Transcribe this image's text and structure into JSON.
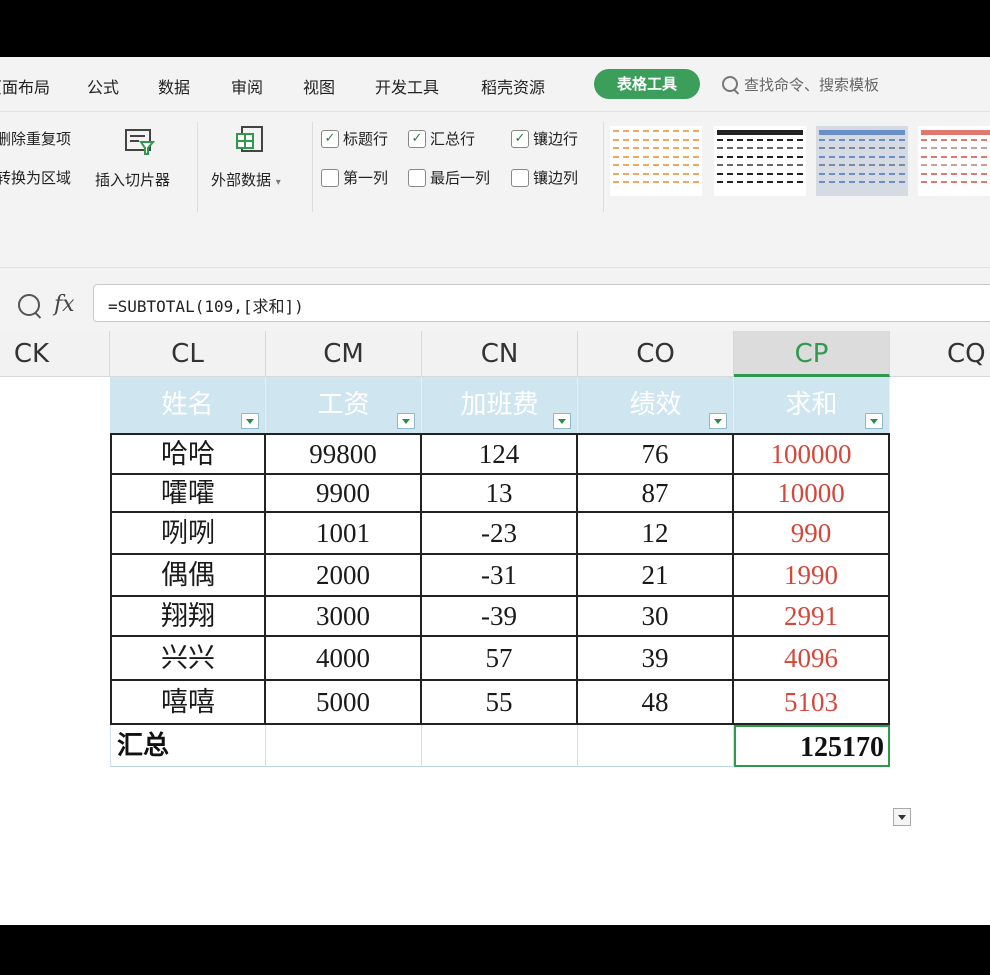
{
  "menu": {
    "items": [
      "页面布局",
      "公式",
      "数据",
      "审阅",
      "视图",
      "开发工具",
      "稻壳资源"
    ],
    "active_tool": "表格工具",
    "search_placeholder": "查找命令、搜索模板"
  },
  "ribbon": {
    "remove_duplicates": "删除重复项",
    "convert_to_range": "转换为区域",
    "insert_slicer": "插入切片器",
    "external_data": "外部数据",
    "options": [
      {
        "label": "标题行",
        "checked": true
      },
      {
        "label": "汇总行",
        "checked": true
      },
      {
        "label": "镶边行",
        "checked": true
      },
      {
        "label": "第一列",
        "checked": false
      },
      {
        "label": "最后一列",
        "checked": false
      },
      {
        "label": "镶边列",
        "checked": false
      }
    ],
    "style_colors": [
      "#f0a860",
      "#222222",
      "#6a8fc8",
      "#e0786e"
    ]
  },
  "formula_bar": {
    "fx": "fx",
    "formula": "=SUBTOTAL(109,[求和])"
  },
  "columns": [
    "CK",
    "CL",
    "CM",
    "CN",
    "CO",
    "CP",
    "CQ"
  ],
  "active_column": "CP",
  "table": {
    "headers": [
      "姓名",
      "工资",
      "加班费",
      "绩效",
      "求和"
    ],
    "rows": [
      [
        "哈哈",
        "99800",
        "124",
        "76",
        "100000"
      ],
      [
        "嚯嚯",
        "9900",
        "13",
        "87",
        "10000"
      ],
      [
        "咧咧",
        "1001",
        "-23",
        "12",
        "990"
      ],
      [
        "偶偶",
        "2000",
        "-31",
        "21",
        "1990"
      ],
      [
        "翔翔",
        "3000",
        "-39",
        "30",
        "2991"
      ],
      [
        "兴兴",
        "4000",
        "57",
        "39",
        "4096"
      ],
      [
        "嘻嘻",
        "5000",
        "55",
        "48",
        "5103"
      ]
    ],
    "total_label": "汇总",
    "total_value": "125170",
    "sum_color": "#d4473b",
    "header_bg": "#cfe6f1",
    "accent": "#2f9a4e"
  }
}
